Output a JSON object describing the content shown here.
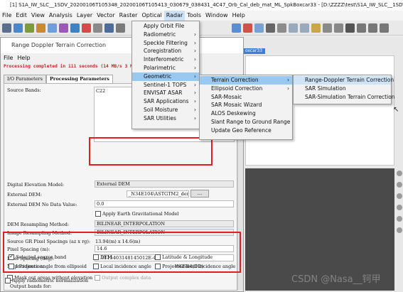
{
  "window": {
    "title": "[1] S1A_IW_SLC__1SDV_20200106T105348_20200106T105413_030679_038431_4C47_Orb_Cal_deb_mat_ML_SpkBoxcar33 - [D:\\ZZZZ\\test\\S1A_IW_SLC__1SDV_20200106T105348..."
  },
  "menubar": [
    "File",
    "Edit",
    "View",
    "Analysis",
    "Layer",
    "Vector",
    "Raster",
    "Optical",
    "Radar",
    "Tools",
    "Window",
    "Help"
  ],
  "active_menu": "Radar",
  "dialog": {
    "title": "Range Doppler Terrain Correction",
    "menu": [
      "File",
      "Help"
    ],
    "status": "Processing completed in 111 seconds (14 MB/s 3 MPixel...",
    "tabs": [
      "I/O Parameters",
      "Processing Parameters"
    ],
    "source_bands_label": "Source Bands:",
    "source_bands": [
      "C22"
    ],
    "dem_label": "Digital Elevation Model:",
    "dem_value": "External DEM",
    "external_dem_label": "External DEM:",
    "external_dem_value": "_N34E104\\ASTGTM2_dem.tif",
    "browse_label": "...",
    "nodata_label": "External DEM No Data Value:",
    "nodata_value": "0.0",
    "egm_label": "Apply Earth Gravitational Model",
    "dem_resampling_label": "DEM Resampling Method:",
    "dem_resampling_value": "BILINEAR_INTERPOLATION",
    "img_resampling_label": "Image Resampling Method:",
    "img_resampling_value": "BILINEAR_INTERPOLATION",
    "source_spacing_label": "Source GR Pixel Spacings (az x rg):",
    "source_spacing_value": "13.94(m) x 14.6(m)",
    "pixel_m_label": "Pixel Spacing (m):",
    "pixel_m_value": "14.6",
    "pixel_deg_label": "Pixel Spacing (deg):",
    "pixel_deg_value": "1.3115403148145012E-4",
    "map_proj_label": "Map Projection:",
    "map_proj_value": "WGS84(DD)",
    "mask_label": "Mask out areas without elevation",
    "complex_label": "Output complex data",
    "output_bands_label": "Output bands for:",
    "cb_selected": "Selected source band",
    "cb_dem": "DEM",
    "cb_latlon": "Latitude & Longitude",
    "cb_inc_ell": "Incidence angle from ellipsoid",
    "cb_local_inc": "Local incidence angle",
    "cb_proj_local": "Projected local incidence angle",
    "radiometric_label": "Apply radiometric normalization"
  },
  "product_tag": "oxcar33",
  "radar_menu": [
    {
      "label": "Apply Orbit File",
      "sub": false
    },
    {
      "label": "Radiometric",
      "sub": true
    },
    {
      "label": "Speckle Filtering",
      "sub": true
    },
    {
      "label": "Coregistration",
      "sub": true
    },
    {
      "label": "Interferometric",
      "sub": true
    },
    {
      "label": "Polarimetric",
      "sub": true
    },
    {
      "label": "Geometric",
      "sub": true
    },
    {
      "label": "Sentinel-1 TOPS",
      "sub": true
    },
    {
      "label": "ENVISAT ASAR",
      "sub": true
    },
    {
      "label": "SAR Applications",
      "sub": true
    },
    {
      "label": "Soil Moisture",
      "sub": true
    },
    {
      "label": "SAR Utilities",
      "sub": true
    }
  ],
  "geometric_menu": [
    {
      "label": "Terrain Correction",
      "sub": true
    },
    {
      "label": "Ellipsoid Correction",
      "sub": true
    },
    {
      "label": "SAR-Mosaic",
      "sub": false
    },
    {
      "label": "SAR Mosaic Wizard",
      "sub": false
    },
    {
      "label": "ALOS Deskewing",
      "sub": false
    },
    {
      "label": "Slant Range to Ground Range",
      "sub": false
    },
    {
      "label": "Update Geo Reference",
      "sub": false
    }
  ],
  "terrain_menu": [
    {
      "label": "Range-Doppler Terrain Correction"
    },
    {
      "label": "SAR Simulation"
    },
    {
      "label": "SAR-Simulation Terrain Correction"
    }
  ],
  "watermark": "CSDN @Nasa__钶甲",
  "colors": {
    "highlight": "#99c8f0",
    "red_box": "#e21f1f",
    "status_red": "#cc2222"
  }
}
